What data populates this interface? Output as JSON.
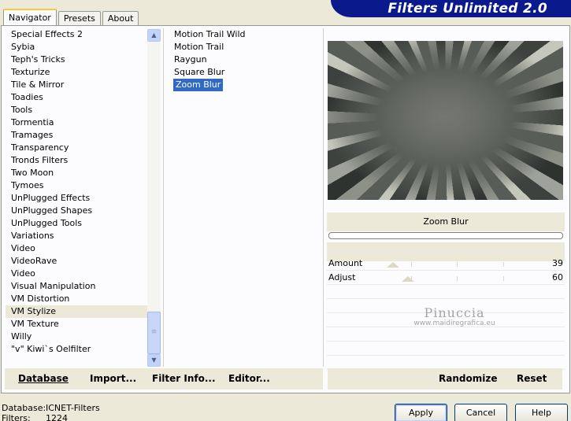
{
  "app": {
    "title": "Filters Unlimited 2.0"
  },
  "tabs": [
    {
      "label": "Navigator",
      "active": true
    },
    {
      "label": "Presets",
      "active": false
    },
    {
      "label": "About",
      "active": false
    }
  ],
  "categories": [
    "Special Effects 2",
    "Sybia",
    "Teph's Tricks",
    "Texturize",
    "Tile & Mirror",
    "Toadies",
    "Tools",
    "Tormentia",
    "Tramages",
    "Transparency",
    "Tronds Filters",
    "Two Moon",
    "Tymoes",
    "UnPlugged Effects",
    "UnPlugged Shapes",
    "UnPlugged Tools",
    "Variations",
    "Video",
    "VideoRave",
    "Video",
    "Visual Manipulation",
    "VM Distortion",
    "VM Stylize",
    "VM Texture",
    "Willy",
    "\"v\" Kiwi`s Oelfilter"
  ],
  "selected_category": "VM Stylize",
  "filters": [
    "Motion Trail Wild",
    "Motion Trail",
    "Raygun",
    "Square Blur",
    "Zoom Blur"
  ],
  "selected_filter": "Zoom Blur",
  "filter_name": "Zoom Blur",
  "params": [
    {
      "name": "Amount",
      "value": "39",
      "level": 39
    },
    {
      "name": "Adjust",
      "value": "60",
      "level": 60
    }
  ],
  "watermark": {
    "title": "Pinuccia",
    "url": "www.maidiregrafica.eu"
  },
  "bottom_links": {
    "database": "Database",
    "import": "Import...",
    "filter_info": "Filter Info...",
    "editor": "Editor...",
    "randomize": "Randomize",
    "reset": "Reset"
  },
  "status": {
    "database_label": "Database:",
    "database_value": "ICNET-Filters",
    "filters_label": "Filters:",
    "filters_value": "1224"
  },
  "buttons": {
    "apply": "Apply",
    "cancel": "Cancel",
    "help": "Help"
  },
  "colors": {
    "brand": "#0a1a8c",
    "selection": "#316ac5",
    "tab_highlight": "#ffc83c"
  }
}
